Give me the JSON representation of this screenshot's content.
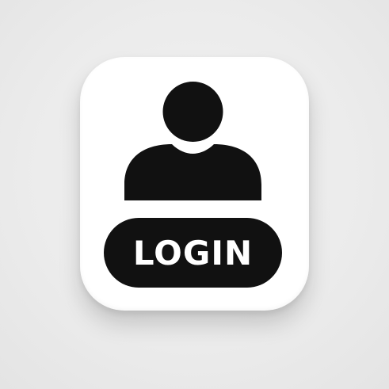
{
  "icon": {
    "name": "user-icon",
    "color": "#111111"
  },
  "button": {
    "label": "LOGIN",
    "background": "#111111",
    "text_color": "#ffffff"
  },
  "tile": {
    "background": "#ffffff"
  }
}
